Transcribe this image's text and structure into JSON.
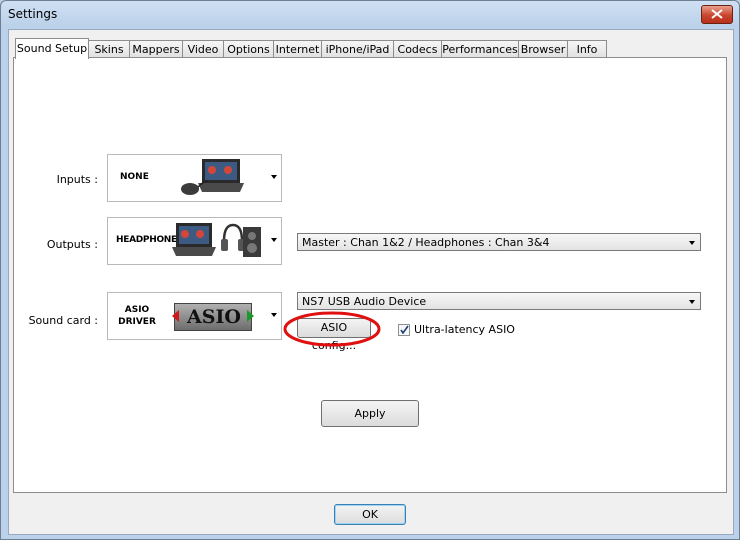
{
  "window": {
    "title": "Settings"
  },
  "tabs": [
    {
      "label": "Sound Setup",
      "active": true
    },
    {
      "label": "Skins"
    },
    {
      "label": "Mappers"
    },
    {
      "label": "Video"
    },
    {
      "label": "Options"
    },
    {
      "label": "Internet"
    },
    {
      "label": "iPhone/iPad"
    },
    {
      "label": "Codecs"
    },
    {
      "label": "Performances"
    },
    {
      "label": "Browser"
    },
    {
      "label": "Info"
    }
  ],
  "inputs": {
    "label": "Inputs :",
    "device": "NONE"
  },
  "outputs": {
    "label": "Outputs :",
    "device": "HEADPHONES",
    "routing": "Master : Chan 1&2 / Headphones : Chan 3&4"
  },
  "soundcard": {
    "label": "Sound card :",
    "device_line1": "ASIO",
    "device_line2": "DRIVER",
    "logo_text": "ASIO",
    "device_name": "NS7 USB Audio Device",
    "asio_config": "ASIO config...",
    "ultra_latency": "Ultra-latency ASIO",
    "ultra_latency_checked": true
  },
  "buttons": {
    "apply": "Apply",
    "ok": "OK"
  },
  "icons": [
    "close-icon",
    "laptop-icon",
    "mouse-icon",
    "headphones-icon",
    "speaker-icon",
    "asio-logo"
  ],
  "colors": {
    "annotation": "#e01010",
    "titlebar": "#bcd2ea",
    "close": "#c9452d"
  }
}
